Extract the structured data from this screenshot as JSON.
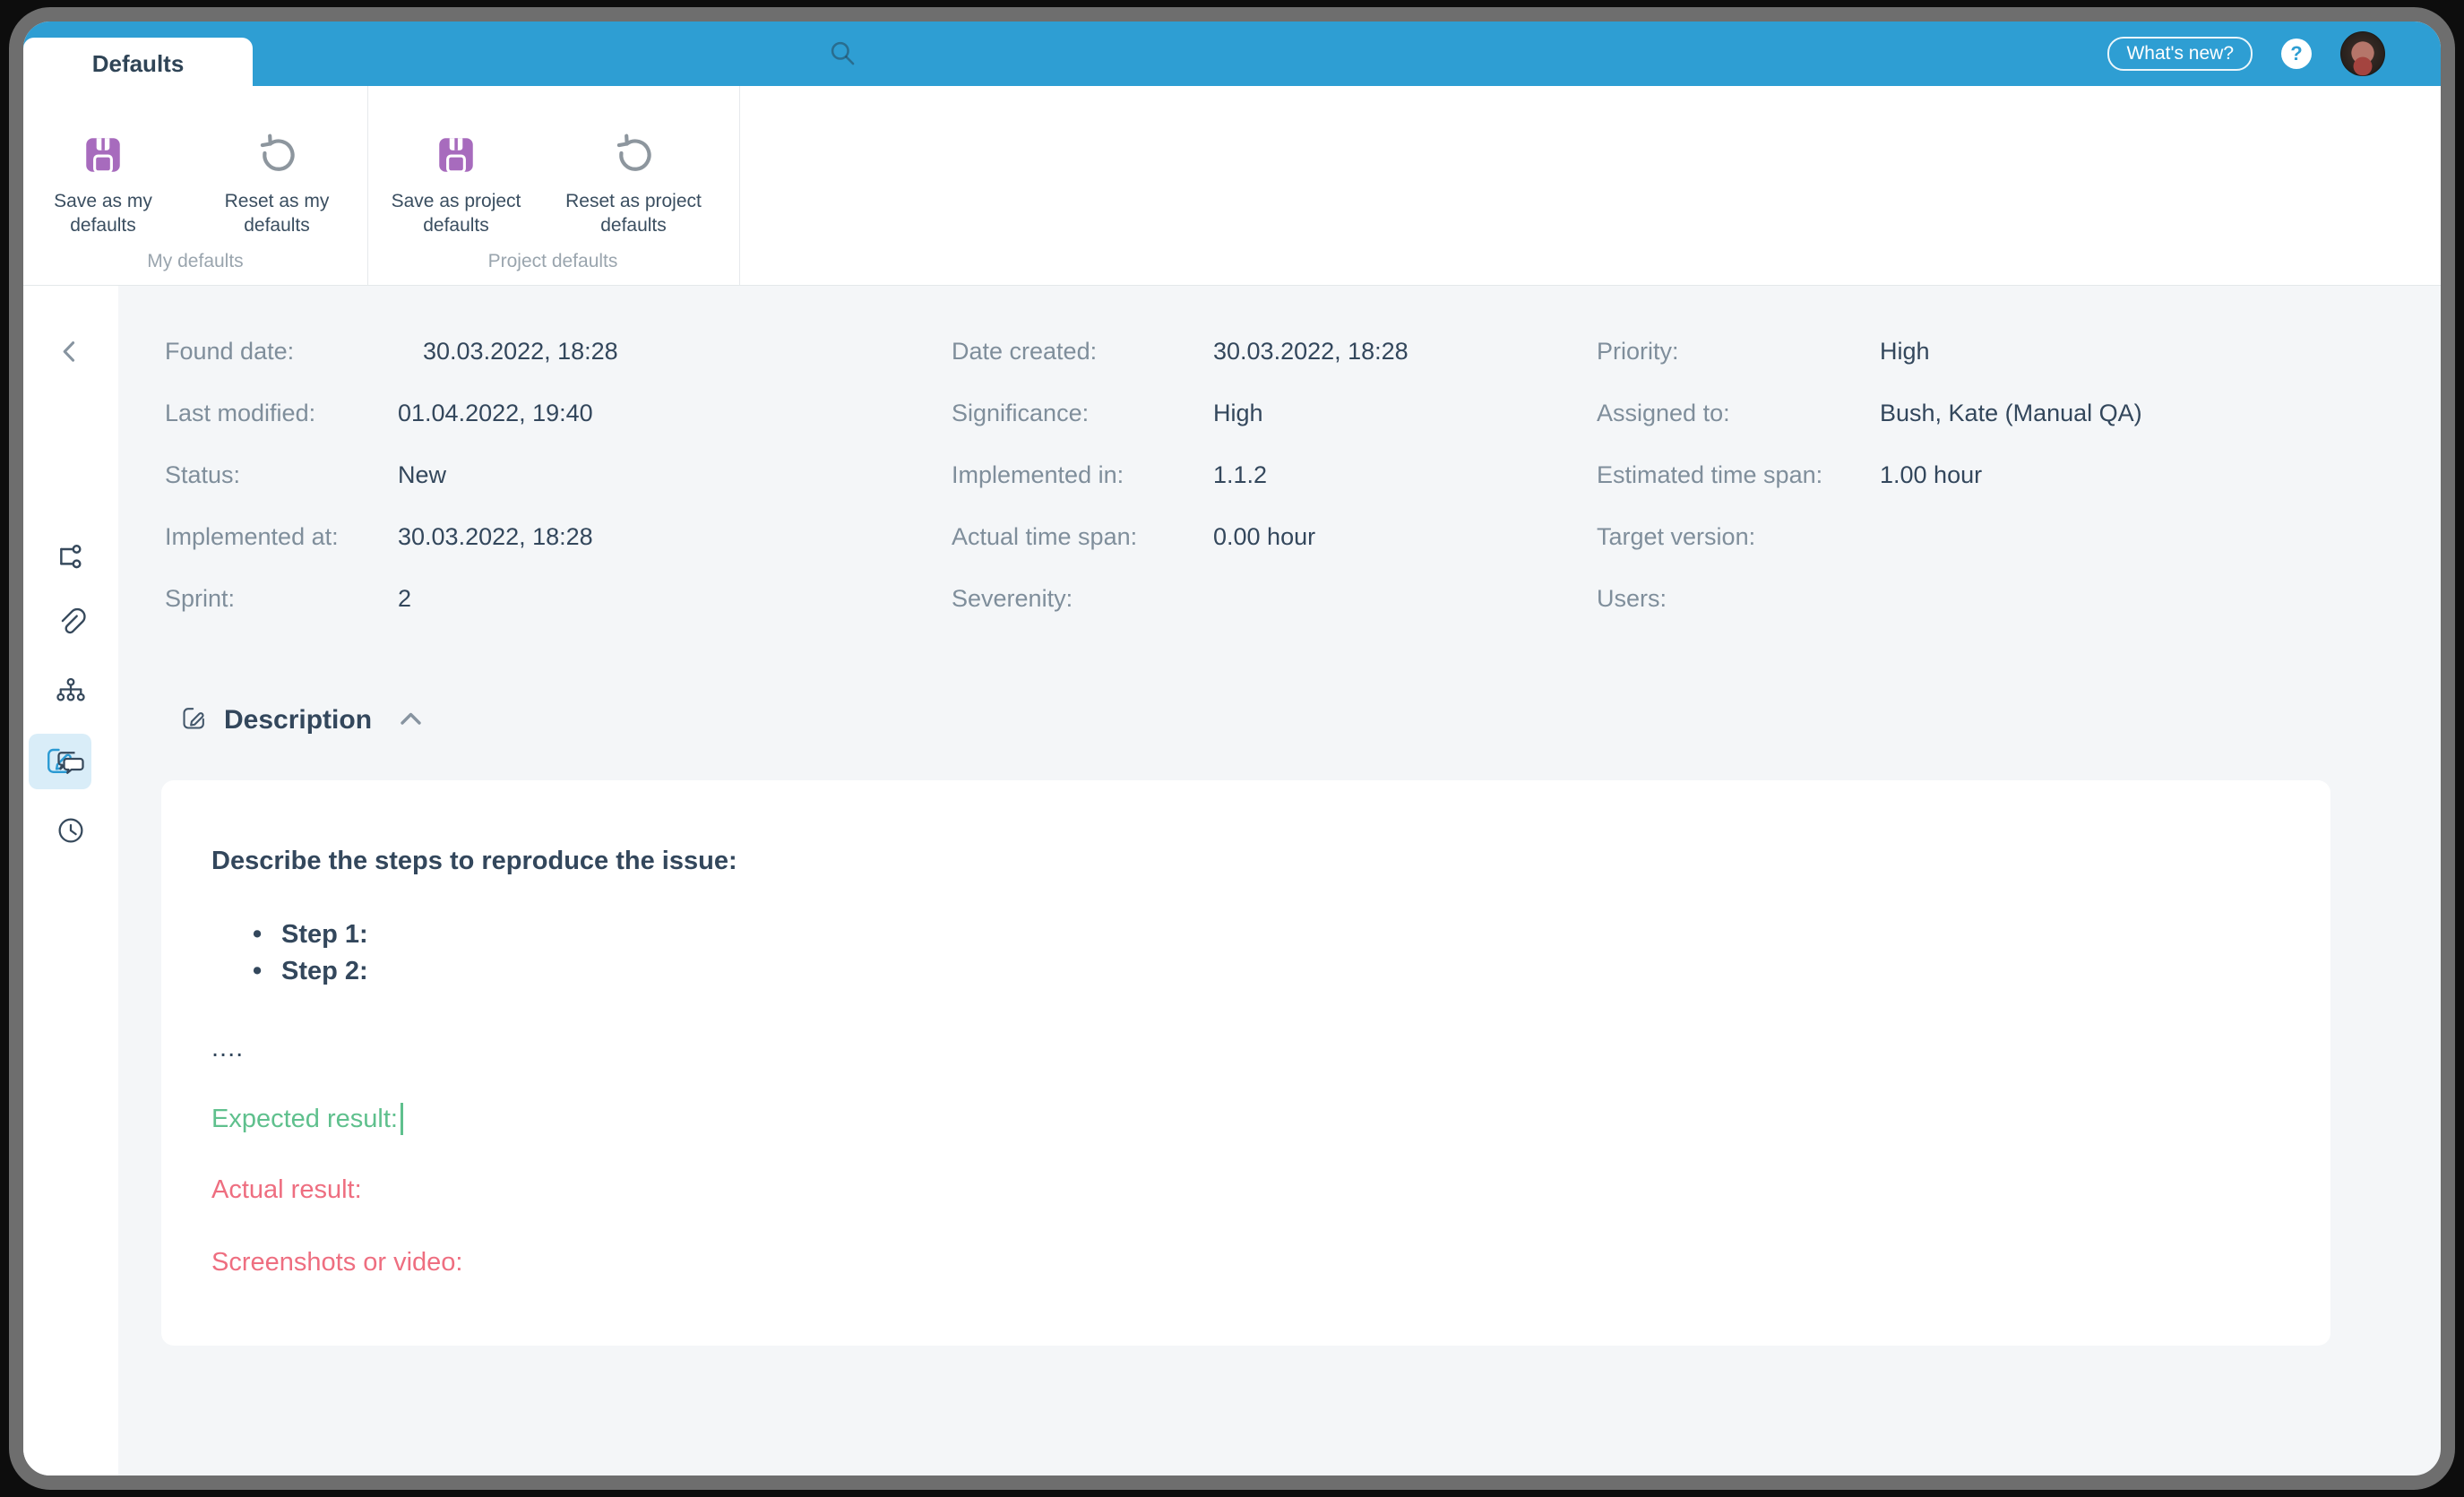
{
  "colors": {
    "accent_blue": "#2e9ed3",
    "navy_text": "#33475c",
    "label_gray": "#7f8e9b",
    "group_label_gray": "#9aa5ae",
    "save_purple": "#a76bbd",
    "expected_green": "#5fc08d",
    "actual_red": "#ee6e80",
    "active_tile_blue": "#d9edf8"
  },
  "icons": [
    "search-icon",
    "question-icon",
    "avatar",
    "save-icon",
    "reset-icon",
    "back-chevron-icon",
    "edit-icon",
    "branch-icon",
    "paperclip-icon",
    "sitemap-icon",
    "comments-icon",
    "clock-icon",
    "chevron-up-icon"
  ],
  "topbar": {
    "whats_new_label": "What's new?",
    "help_label": "?"
  },
  "tab": {
    "label": "Defaults"
  },
  "ribbon": {
    "buttons": [
      {
        "icon": "save-icon",
        "label": "Save as my defaults"
      },
      {
        "icon": "reset-icon",
        "label": "Reset as my defaults"
      },
      {
        "icon": "save-icon",
        "label": "Save as project defaults"
      },
      {
        "icon": "reset-icon",
        "label": "Reset as project defaults"
      }
    ],
    "groups": [
      {
        "label": "My defaults"
      },
      {
        "label": "Project defaults"
      }
    ]
  },
  "fields": {
    "cols": [
      {
        "rows": [
          {
            "label": "Found date:",
            "value": "30.03.2022, 18:28"
          },
          {
            "label": "Last modified:",
            "value": "01.04.2022, 19:40"
          },
          {
            "label": "Status:",
            "value": "New"
          },
          {
            "label": "Implemented at:",
            "value": "30.03.2022, 18:28"
          },
          {
            "label": "Sprint:",
            "value": "2"
          }
        ]
      },
      {
        "rows": [
          {
            "label": "Date created:",
            "value": "30.03.2022, 18:28"
          },
          {
            "label": "Significance:",
            "value": "High"
          },
          {
            "label": "Implemented in:",
            "value": "1.1.2"
          },
          {
            "label": "Actual time span:",
            "value": "0.00 hour"
          },
          {
            "label": "Severenity:",
            "value": ""
          }
        ]
      },
      {
        "rows": [
          {
            "label": "Priority:",
            "value": "High"
          },
          {
            "label": "Assigned to:",
            "value": "Bush, Kate (Manual QA)"
          },
          {
            "label": "Estimated time span:",
            "value": "1.00 hour"
          },
          {
            "label": "Target version:",
            "value": ""
          },
          {
            "label": "Users:",
            "value": ""
          }
        ]
      }
    ]
  },
  "description": {
    "title": "Description"
  },
  "editor": {
    "heading": "Describe the steps to reproduce the issue:",
    "steps": [
      "Step 1:",
      "Step 2:"
    ],
    "dots": "....",
    "expected": "Expected result:",
    "actual": "Actual result:",
    "screenshots": "Screenshots or video:"
  }
}
